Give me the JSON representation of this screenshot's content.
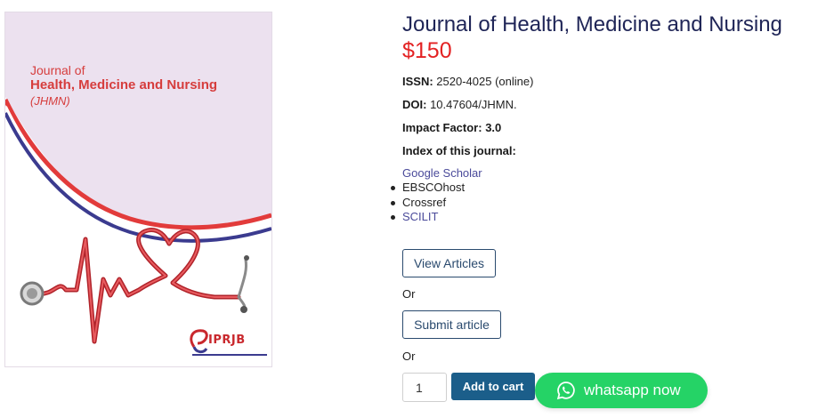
{
  "cover": {
    "line1": "Journal of",
    "line2": "Health, Medicine and Nursing",
    "line3": "(JHMN)",
    "logo": "IPRJB",
    "logo_icon": "ribbon-logo-icon",
    "colors": {
      "background": "#ece1ef",
      "red": "#d63d3d",
      "blue": "#3b3b8f"
    }
  },
  "product": {
    "title": "Journal of Health, Medicine and Nursing",
    "price": "$150",
    "issn_label": "ISSN:",
    "issn_value": "2520-4025 (online)",
    "doi_label": "DOI:",
    "doi_value": "10.47604/JHMN.",
    "impact_label": "Impact Factor:",
    "impact_value": "3.0",
    "index_label": "Index of this journal:",
    "index_first": "Google Scholar",
    "index_items": [
      "EBSCOhost",
      "Crossref",
      "SCILIT"
    ]
  },
  "actions": {
    "view_articles": "View Articles",
    "or1": "Or",
    "submit_article": "Submit article",
    "or2": "Or",
    "quantity": "1",
    "add_to_cart": "Add to cart"
  },
  "whatsapp": {
    "label": "whatsapp now",
    "icon": "whatsapp-icon",
    "color": "#25d366"
  },
  "colors": {
    "title": "#1f2557",
    "price": "#e32223",
    "button": "#1b5e8a",
    "link": "#4a4a9a"
  }
}
